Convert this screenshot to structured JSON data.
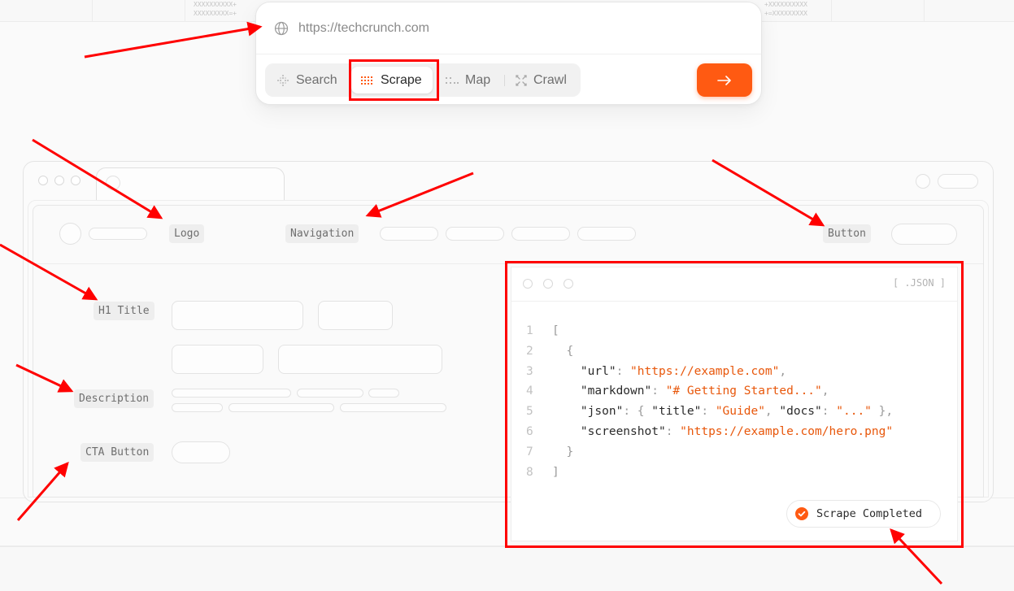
{
  "background": {
    "pattern_left": "XXXXXXXXXX+\nXXXXXXXXX=+",
    "pattern_right": "+XXXXXXXXXX\n+=XXXXXXXXX"
  },
  "url_bar": {
    "placeholder": "https://techcrunch.com",
    "icon": "globe-icon"
  },
  "modes": [
    {
      "label": "Search",
      "icon": "search-dots-icon",
      "active": false
    },
    {
      "label": "Scrape",
      "icon": "scrape-dots-icon",
      "active": true
    },
    {
      "label": "Map",
      "icon": "map-dots-icon",
      "active": false
    },
    {
      "label": "Crawl",
      "icon": "crawl-icon",
      "active": false
    }
  ],
  "submit": {
    "icon": "arrow-right-icon",
    "color": "#ff5a12"
  },
  "labels": {
    "logo": "Logo",
    "navigation": "Navigation",
    "button": "Button",
    "h1_title": "H1 Title",
    "description": "Description",
    "cta_button": "CTA Button"
  },
  "json_panel": {
    "extension": "[ .JSON ]",
    "line_numbers": [
      "1",
      "2",
      "3",
      "4",
      "5",
      "6",
      "7",
      "8"
    ],
    "lines": {
      "l1": "[",
      "l2": "{",
      "l3_key": "\"url\"",
      "l3_val": "\"https://example.com\"",
      "l4_key": "\"markdown\"",
      "l4_val": "\"# Getting Started...\"",
      "l5_key": "\"json\"",
      "l5_k1": "\"title\"",
      "l5_v1": "\"Guide\"",
      "l5_k2": "\"docs\"",
      "l5_v2": "\"...\"",
      "l6_key": "\"screenshot\"",
      "l6_val": "\"https://example.com/hero.png\"",
      "l7": "}",
      "l8": "]"
    },
    "status": "Scrape Completed",
    "status_color": "#ff5a12"
  },
  "annotation_color": "#ff0000"
}
